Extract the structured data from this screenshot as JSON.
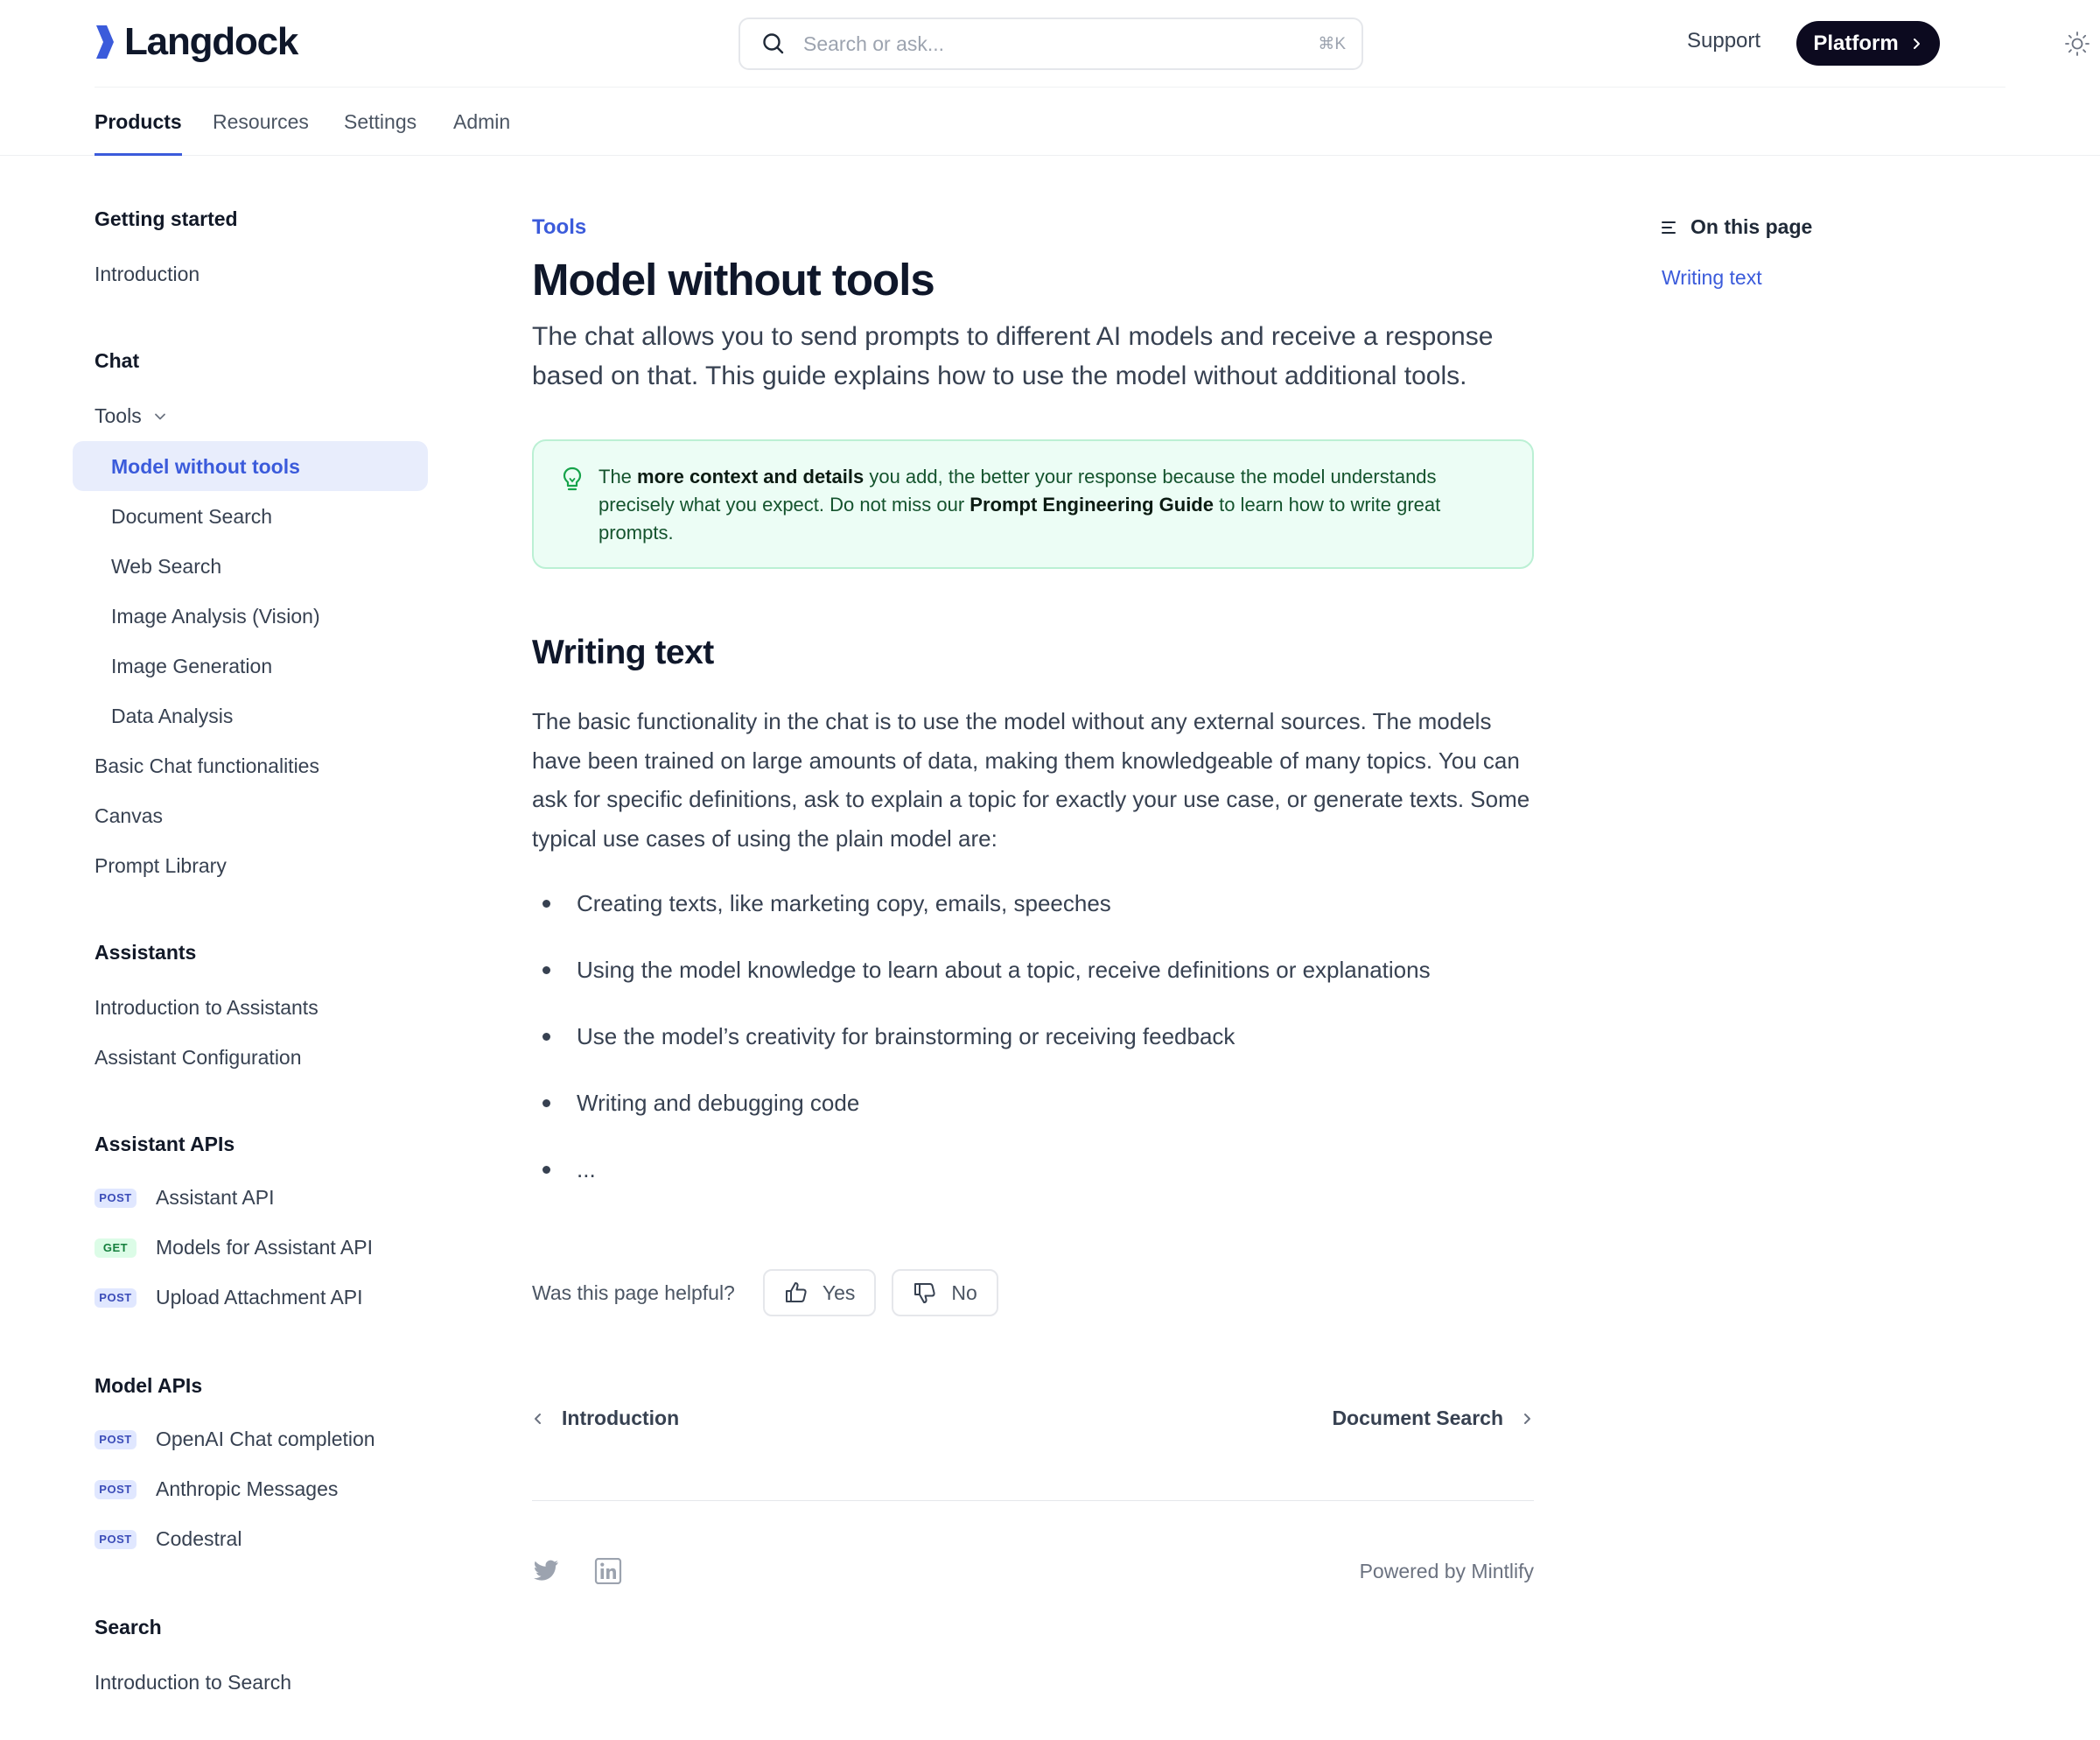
{
  "brand": {
    "name": "Langdock",
    "accent": "#3b5bdb"
  },
  "header": {
    "search_placeholder": "Search or ask...",
    "search_shortcut": "⌘K",
    "support_label": "Support",
    "platform_label": "Platform",
    "theme_icon": "sun-icon"
  },
  "tabs": [
    {
      "label": "Products",
      "active": true
    },
    {
      "label": "Resources"
    },
    {
      "label": "Settings"
    },
    {
      "label": "Admin"
    }
  ],
  "sidebar": {
    "getting_started": {
      "title": "Getting started",
      "items": [
        "Introduction"
      ]
    },
    "chat": {
      "title": "Chat",
      "tools_label": "Tools",
      "tools_children": [
        "Model without tools",
        "Document Search",
        "Web Search",
        "Image Analysis (Vision)",
        "Image Generation",
        "Data Analysis"
      ],
      "items": [
        "Basic Chat functionalities",
        "Canvas",
        "Prompt Library"
      ]
    },
    "assistants": {
      "title": "Assistants",
      "items": [
        "Introduction to Assistants",
        "Assistant Configuration"
      ]
    },
    "assistant_apis": {
      "title": "Assistant APIs",
      "items": [
        {
          "method": "POST",
          "label": "Assistant API"
        },
        {
          "method": "GET",
          "label": "Models for Assistant API"
        },
        {
          "method": "POST",
          "label": "Upload Attachment API"
        }
      ]
    },
    "model_apis": {
      "title": "Model APIs",
      "items": [
        {
          "method": "POST",
          "label": "OpenAI Chat completion"
        },
        {
          "method": "POST",
          "label": "Anthropic Messages"
        },
        {
          "method": "POST",
          "label": "Codestral"
        }
      ]
    },
    "search": {
      "title": "Search",
      "items": [
        "Introduction to Search"
      ]
    }
  },
  "main": {
    "eyebrow": "Tools",
    "title": "Model without tools",
    "lead": "The chat allows you to send prompts to different AI models and receive a response based on that. This guide explains how to use the model without additional tools.",
    "callout": {
      "icon": "lightbulb-icon",
      "pre": "The ",
      "strong1": "more context and details",
      "mid": " you add, the better your response because the model understands precisely what you expect. Do not miss our ",
      "strong2": "Prompt Engineering Guide",
      "post": " to learn how to write great prompts."
    },
    "section_title": "Writing text",
    "body": "The basic functionality in the chat is to use the model without any external sources. The models have been trained on large amounts of data, making them knowledgeable of many topics. You can ask for specific definitions, ask to explain a topic for exactly your use case, or generate texts. Some typical use cases of using the plain model are:",
    "bullets": [
      "Creating texts, like marketing copy, emails, speeches",
      "Using the model knowledge to learn about a topic, receive definitions or explanations",
      "Use the model’s creativity for brainstorming or receiving feedback",
      "Writing and debugging code",
      "..."
    ],
    "feedback": {
      "question": "Was this page helpful?",
      "yes": "Yes",
      "no": "No"
    },
    "pager": {
      "prev": "Introduction",
      "next": "Document Search"
    },
    "footer": {
      "powered": "Powered by Mintlify",
      "social": [
        "twitter-icon",
        "linkedin-icon"
      ]
    }
  },
  "toc": {
    "title": "On this page",
    "items": [
      "Writing text"
    ]
  }
}
